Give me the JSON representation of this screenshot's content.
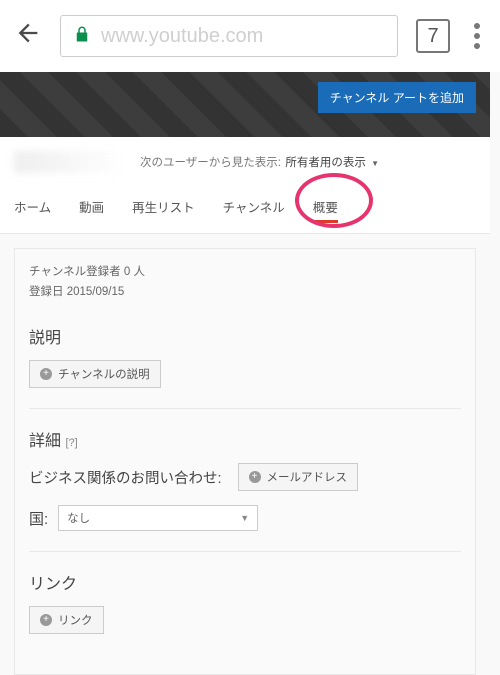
{
  "browser": {
    "url_display": "www.youtube.com",
    "tab_count": "7"
  },
  "banner": {
    "add_art_button": "チャンネル アートを追加"
  },
  "header": {
    "view_as_label": "次のユーザーから見た表示:",
    "view_as_value": "所有者用の表示"
  },
  "tabs": [
    {
      "label": "ホーム",
      "active": false
    },
    {
      "label": "動画",
      "active": false
    },
    {
      "label": "再生リスト",
      "active": false
    },
    {
      "label": "チャンネル",
      "active": false
    },
    {
      "label": "概要",
      "active": true
    }
  ],
  "stats": {
    "subscribers": "チャンネル登録者 0 人",
    "joined": "登録日 2015/09/15"
  },
  "sections": {
    "description_title": "説明",
    "description_button": "チャンネルの説明",
    "details_title": "詳細",
    "help_symbol": "[?]",
    "business_label": "ビジネス関係のお問い合わせ:",
    "email_button": "メールアドレス",
    "country_label": "国:",
    "country_value": "なし",
    "links_title": "リンク",
    "links_button": "リンク"
  }
}
